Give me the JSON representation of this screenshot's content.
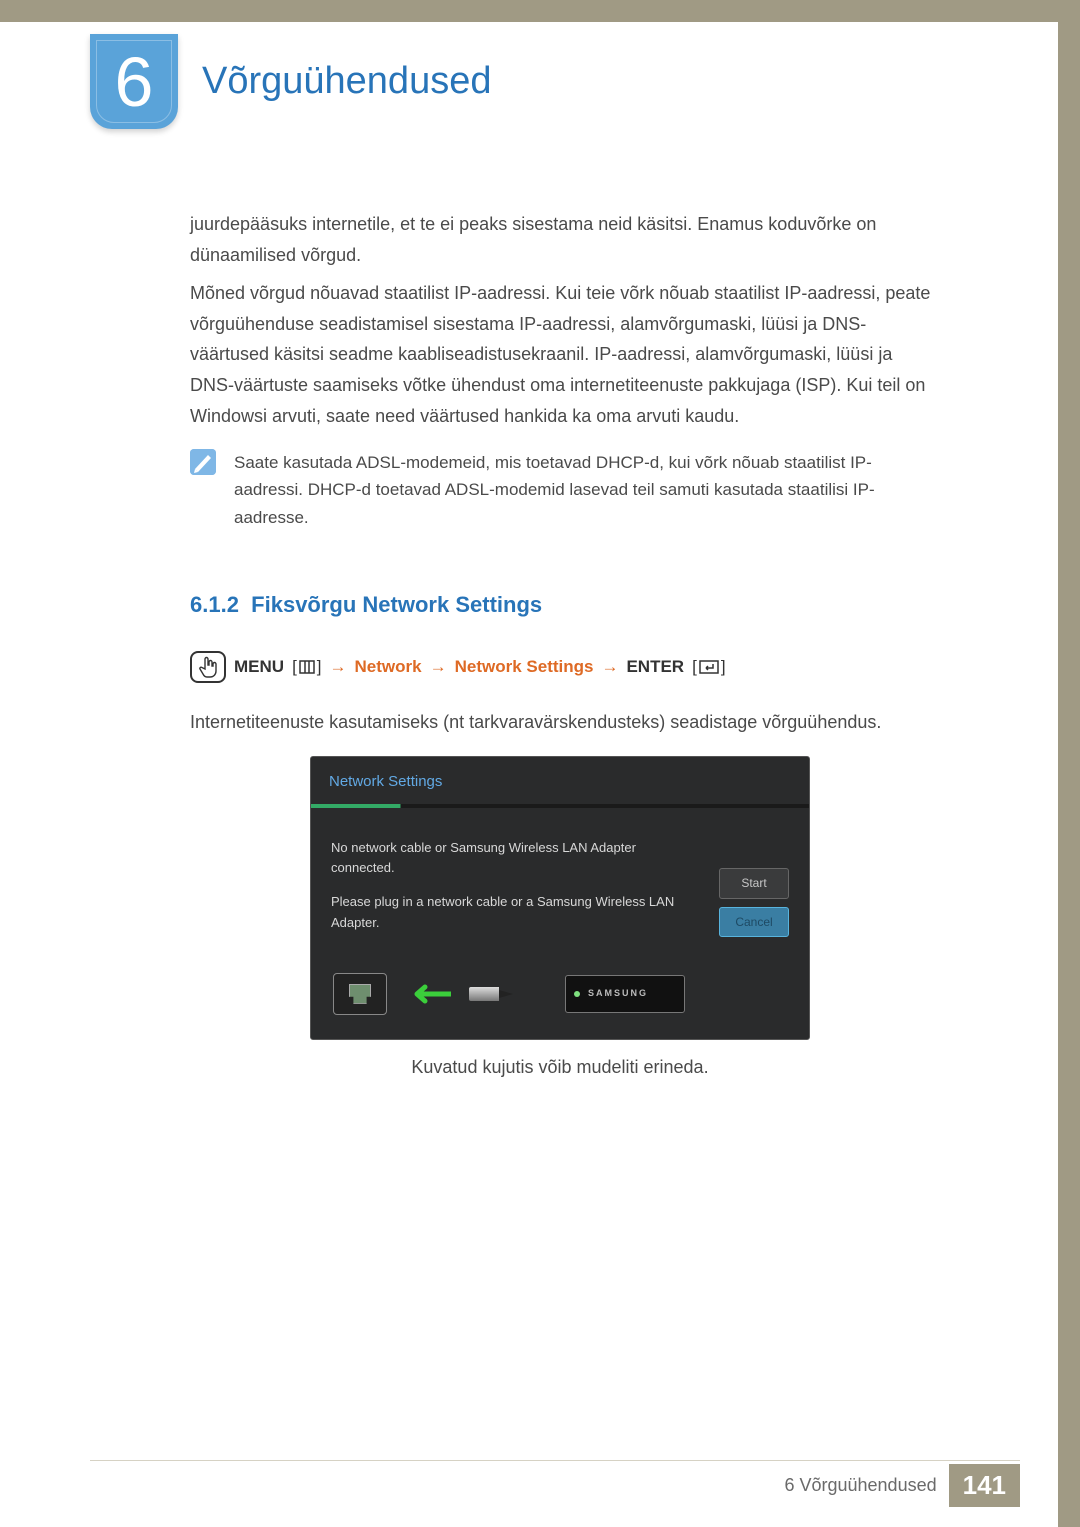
{
  "chapter": {
    "number": "6",
    "title": "Võrguühendused"
  },
  "paragraphs": {
    "p1": "juurdepääsuks internetile, et te ei peaks sisestama neid käsitsi. Enamus koduvõrke on dünaamilised võrgud.",
    "p2": "Mõned võrgud nõuavad staatilist IP-aadressi. Kui teie võrk nõuab staatilist IP-aadressi, peate võrguühenduse seadistamisel sisestama IP-aadressi, alamvõrgumaski, lüüsi ja DNS-väärtused käsitsi seadme kaabliseadistusekraanil. IP-aadressi, alamvõrgumaski, lüüsi ja DNS-väärtuste saamiseks võtke ühendust oma internetiteenuste pakkujaga (ISP). Kui teil on Windowsi arvuti, saate need väärtused hankida ka oma arvuti kaudu."
  },
  "note": "Saate kasutada ADSL-modemeid, mis toetavad DHCP-d, kui võrk nõuab staatilist IP-aadressi. DHCP-d toetavad ADSL-modemid lasevad teil samuti kasutada staatilisi IP-aadresse.",
  "section": {
    "number": "6.1.2",
    "title": "Fiksvõrgu Network Settings"
  },
  "menupath": {
    "menu": "MENU",
    "net1": "Network",
    "net2": "Network Settings",
    "enter": "ENTER"
  },
  "body_after_path": "Internetiteenuste kasutamiseks (nt tarkvaravärskendusteks) seadistage võrguühendus.",
  "dialog": {
    "title": "Network Settings",
    "msg1": "No network cable or Samsung Wireless LAN Adapter connected.",
    "msg2": "Please plug in a network cable or a Samsung Wireless LAN Adapter.",
    "start": "Start",
    "cancel": "Cancel",
    "brand": "SAMSUNG"
  },
  "caption": "Kuvatud kujutis võib mudeliti erineda.",
  "footer": {
    "label": "6 Võrguühendused",
    "page": "141"
  }
}
